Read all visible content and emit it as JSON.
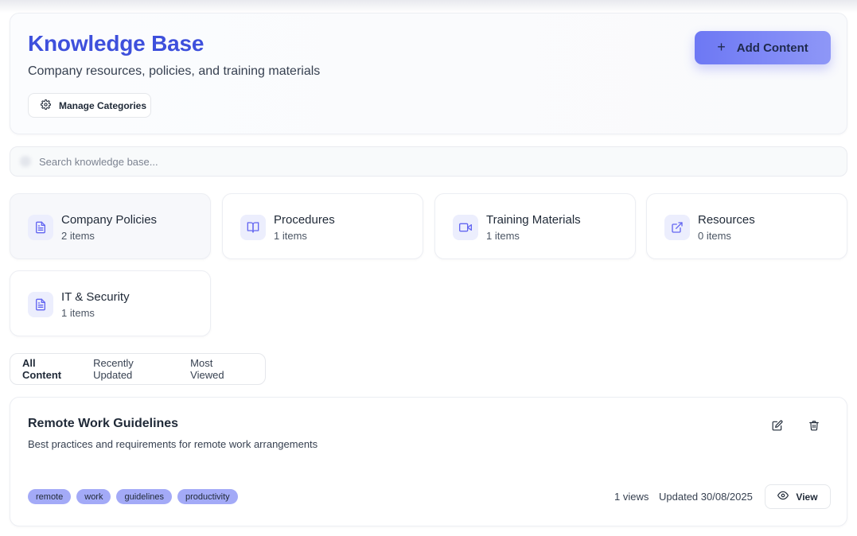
{
  "header": {
    "title": "Knowledge Base",
    "subtitle": "Company resources, policies, and training materials",
    "manage_label": "Manage Categories",
    "add_label": "Add Content"
  },
  "search": {
    "placeholder": "Search knowledge base..."
  },
  "categories": [
    {
      "name": "Company Policies",
      "count": "2 items",
      "icon": "document-icon"
    },
    {
      "name": "Procedures",
      "count": "1 items",
      "icon": "book-icon"
    },
    {
      "name": "Training Materials",
      "count": "1 items",
      "icon": "video-icon"
    },
    {
      "name": "Resources",
      "count": "0 items",
      "icon": "external-link-icon"
    },
    {
      "name": "IT & Security",
      "count": "1 items",
      "icon": "document-icon"
    }
  ],
  "tabs": [
    "All Content",
    "Recently Updated",
    "Most Viewed"
  ],
  "content_items": [
    {
      "title": "Remote Work Guidelines",
      "description": "Best practices and requirements for remote work arrangements",
      "tags": [
        "remote",
        "work",
        "guidelines",
        "productivity"
      ],
      "views": "1 views",
      "updated": "Updated 30/08/2025",
      "view_label": "View"
    }
  ],
  "colors": {
    "accent": "#3e50dc",
    "button_gradient_start": "#6d78f4",
    "tag_bg": "#a3aaf7",
    "icon_bg": "#eceefd",
    "icon_stroke": "#6366f1"
  }
}
